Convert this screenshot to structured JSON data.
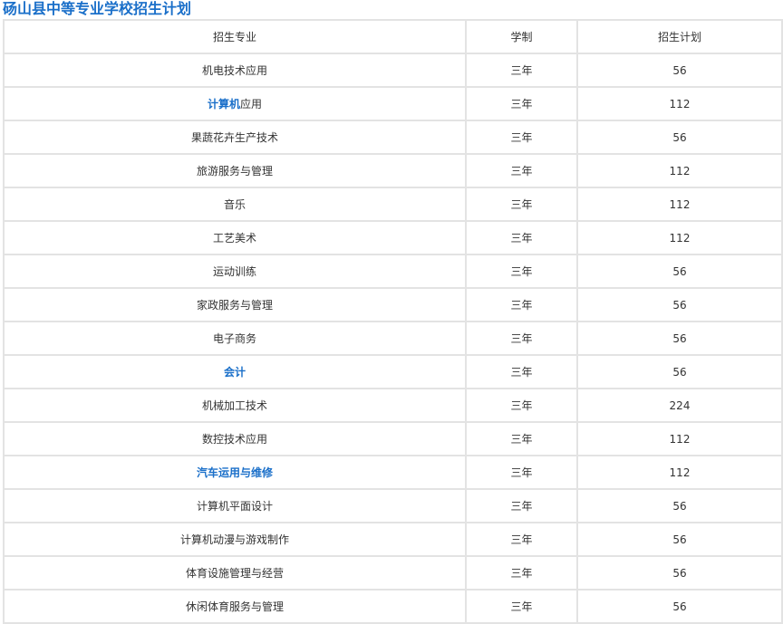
{
  "title": "砀山县中等专业学校招生计划",
  "colors": {
    "title": "#1a6fc9",
    "link": "#1a6fc9",
    "border": "#e3e3e3",
    "text": "#333333"
  },
  "table": {
    "headers": [
      "招生专业",
      "学制",
      "招生计划"
    ],
    "rows": [
      {
        "major": "机电技术应用",
        "years": "三年",
        "plan": "56"
      },
      {
        "major_link": "计算机",
        "major_suffix": "应用",
        "years": "三年",
        "plan": "112"
      },
      {
        "major": "果蔬花卉生产技术",
        "years": "三年",
        "plan": "56"
      },
      {
        "major": "旅游服务与管理",
        "years": "三年",
        "plan": "112"
      },
      {
        "major": "音乐",
        "years": "三年",
        "plan": "112"
      },
      {
        "major": "工艺美术",
        "years": "三年",
        "plan": "112"
      },
      {
        "major": "运动训练",
        "years": "三年",
        "plan": "56"
      },
      {
        "major": "家政服务与管理",
        "years": "三年",
        "plan": "56"
      },
      {
        "major": "电子商务",
        "years": "三年",
        "plan": "56"
      },
      {
        "major_link": "会计",
        "years": "三年",
        "plan": "56"
      },
      {
        "major": "机械加工技术",
        "years": "三年",
        "plan": "224"
      },
      {
        "major": "数控技术应用",
        "years": "三年",
        "plan": "112"
      },
      {
        "major_link": "汽车运用与维修",
        "years": "三年",
        "plan": "112"
      },
      {
        "major": "计算机平面设计",
        "years": "三年",
        "plan": "56"
      },
      {
        "major": "计算机动漫与游戏制作",
        "years": "三年",
        "plan": "56"
      },
      {
        "major": "体育设施管理与经营",
        "years": "三年",
        "plan": "56"
      },
      {
        "major": "休闲体育服务与管理",
        "years": "三年",
        "plan": "56"
      }
    ]
  }
}
